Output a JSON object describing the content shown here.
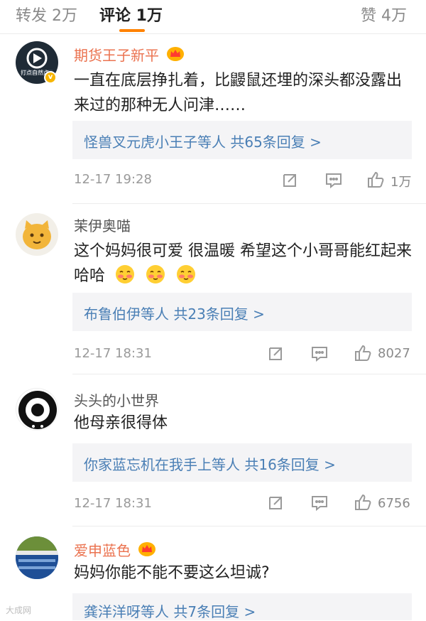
{
  "tabs": {
    "repost": "转发 2万",
    "comments": "评论 1万",
    "likes": "赞 4万"
  },
  "comments": [
    {
      "username": "期货王子新平",
      "text": "一直在底层挣扎着，比鼹鼠还埋的深头都没露出来过的那种无人问津……",
      "replies": "怪兽叉元虎小王子等人  共65条回复 >",
      "time": "12-17 19:28",
      "likes": "1万",
      "avatar_text": "打点自然点"
    },
    {
      "username": "茉伊奥喵",
      "text": "这个妈妈很可爱 很温暖 希望这个小哥哥能红起来 哈哈",
      "replies": "布鲁伯伊等人  共23条回复 >",
      "time": "12-17 18:31",
      "likes": "8027"
    },
    {
      "username": "头头的小世界",
      "text": "他母亲很得体",
      "replies": "你家蓝忘机在我手上等人  共16条回复 >",
      "time": "12-17 18:31",
      "likes": "6756"
    },
    {
      "username": "爱申蓝色",
      "text": "妈妈你能不能不要这么坦诚?",
      "replies": "龚洋洋呀等人  共7条回复 >"
    }
  ],
  "watermark": "大成网",
  "colors": {
    "accent": "#ff8200",
    "vip_name": "#eb7350",
    "link": "#4a7fb5",
    "reply_bg": "#f4f4f6"
  },
  "icons": [
    "crown-icon",
    "share-icon",
    "comment-icon",
    "like-icon",
    "blush-emoji-icon",
    "verified-badge-icon"
  ]
}
